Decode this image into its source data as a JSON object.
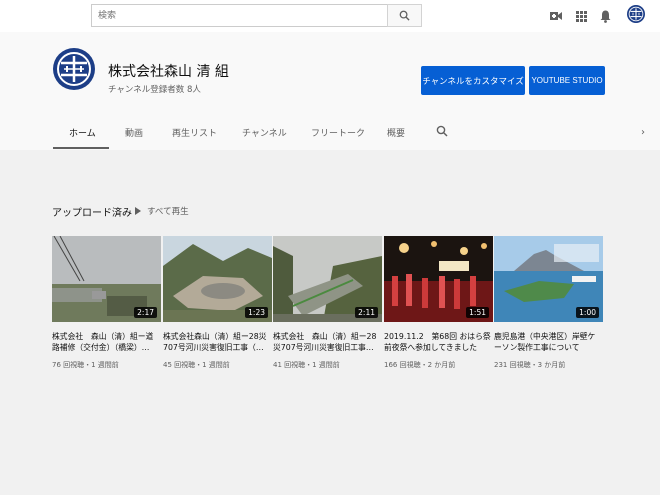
{
  "search": {
    "placeholder": "検索"
  },
  "channel": {
    "name": "株式会社森山 清 組",
    "subscribers": "チャンネル登録者数 8人",
    "customize_label": "チャンネルをカスタマイズ",
    "studio_label": "YOUTUBE STUDIO"
  },
  "tabs": [
    {
      "label": "ホーム",
      "active": true
    },
    {
      "label": "動画"
    },
    {
      "label": "再生リスト"
    },
    {
      "label": "チャンネル"
    },
    {
      "label": "フリートーク"
    },
    {
      "label": "概要"
    }
  ],
  "section": {
    "title": "アップロード済み",
    "play_all": "すべて再生"
  },
  "videos": [
    {
      "title": "株式会社　森山（清）組ー道路補修（交付金）（橋梁）…",
      "meta": "76 回視聴・1 週間前",
      "duration": "2:17"
    },
    {
      "title": "株式会社森山（清）組ー28災707号河川災害復旧工事（…",
      "meta": "45 回視聴・1 週間前",
      "duration": "1:23"
    },
    {
      "title": "株式会社　森山（清）組ー28災707号河川災害復旧工事…",
      "meta": "41 回視聴・1 週間前",
      "duration": "2:11"
    },
    {
      "title": "2019.11.2　第68回 おはら祭前夜祭へ参加してきました",
      "meta": "166 回視聴・2 か月前",
      "duration": "1:51"
    },
    {
      "title": "鹿児島港（中央港区）岸壁ケーソン製作工事について",
      "meta": "231 回視聴・3 か月前",
      "duration": "1:00"
    }
  ],
  "colors": {
    "accent": "#065fd4",
    "logo": "#1d3e87"
  },
  "icons": [
    "search-icon",
    "video-camera-icon",
    "apps-grid-icon",
    "bell-icon",
    "chevron-right-icon",
    "play-icon"
  ]
}
